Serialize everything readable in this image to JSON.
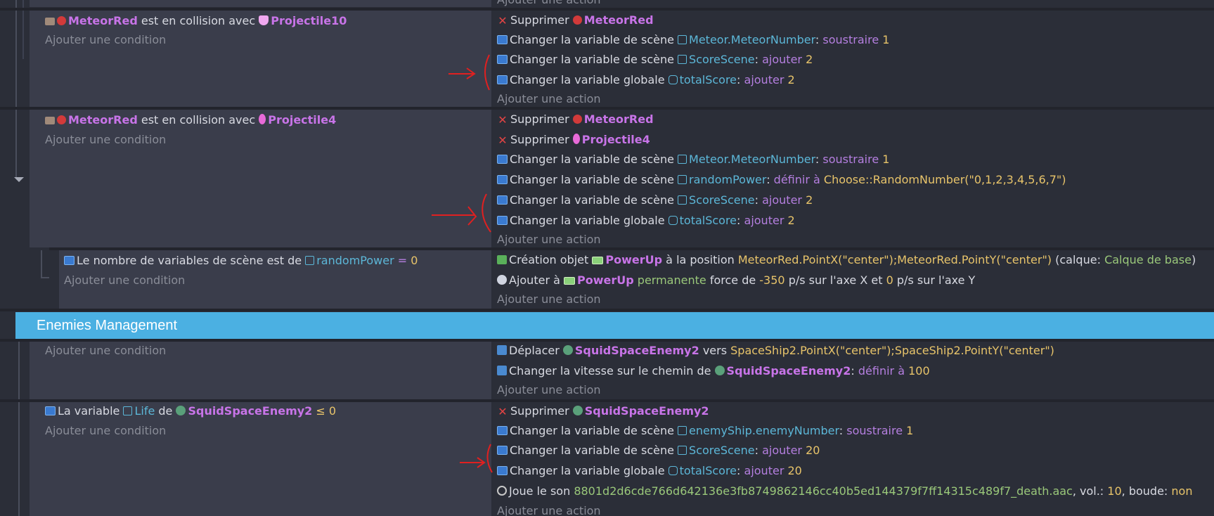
{
  "topcut": {
    "text": "Ajouter une action"
  },
  "event1": {
    "condition": {
      "object": "MeteorRed",
      "middle": "est en collision avec",
      "target": "Projectile10"
    },
    "add_condition": "Ajouter une condition",
    "actions": [
      {
        "type": "delete",
        "verb": "Supprimer",
        "object": "MeteorRed"
      },
      {
        "type": "var",
        "verb": "Changer la variable de scène",
        "variable": "Meteor.MeteorNumber",
        "op": "soustraire",
        "value": "1"
      },
      {
        "type": "var",
        "verb": "Changer la variable de scène",
        "variable": "ScoreScene",
        "op": "ajouter",
        "value": "2"
      },
      {
        "type": "gvar",
        "verb": "Changer la variable globale",
        "variable": "totalScore",
        "op": "ajouter",
        "value": "2"
      }
    ],
    "add_action": "Ajouter une action"
  },
  "event2": {
    "condition": {
      "object": "MeteorRed",
      "middle": "est en collision avec",
      "target": "Projectile4"
    },
    "add_condition": "Ajouter une condition",
    "actions": [
      {
        "type": "delete",
        "verb": "Supprimer",
        "object": "MeteorRed"
      },
      {
        "type": "delete",
        "verb": "Supprimer",
        "object": "Projectile4"
      },
      {
        "type": "var",
        "verb": "Changer la variable de scène",
        "variable": "Meteor.MeteorNumber",
        "op": "soustraire",
        "value": "1"
      },
      {
        "type": "var",
        "verb": "Changer la variable de scène",
        "variable": "randomPower",
        "op": "définir à",
        "value": "Choose::RandomNumber(\"0,1,2,3,4,5,6,7\")"
      },
      {
        "type": "var",
        "verb": "Changer la variable de scène",
        "variable": "ScoreScene",
        "op": "ajouter",
        "value": "2"
      },
      {
        "type": "gvar",
        "verb": "Changer la variable globale",
        "variable": "totalScore",
        "op": "ajouter",
        "value": "2"
      }
    ],
    "add_action": "Ajouter une action"
  },
  "event3": {
    "condition": {
      "text": "Le nombre de variables de scène est de",
      "variable": "randomPower",
      "eq": "=",
      "value": "0"
    },
    "add_condition": "Ajouter une condition",
    "actions": [
      {
        "verb": "Création objet",
        "object": "PowerUp",
        "pos_text": "à la position",
        "expr": "MeteorRed.PointX(\"center\");MeteorRed.PointY(\"center\")",
        "layer_open": "(calque:",
        "layer": "Calque de base",
        "layer_close": ")"
      },
      {
        "verb": "Ajouter à",
        "object": "PowerUp",
        "perm": "permanente",
        "f1": "force de",
        "xval": "-350",
        "f2": "p/s sur l'axe X et",
        "yval": "0",
        "f3": "p/s sur l'axe Y"
      }
    ],
    "add_action": "Ajouter une action"
  },
  "group": {
    "title": "Enemies Management"
  },
  "event4": {
    "add_condition": "Ajouter une condition",
    "actions": [
      {
        "verb": "Déplacer",
        "object": "SquidSpaceEnemy2",
        "mid": "vers",
        "expr": "SpaceShip2.PointX(\"center\");SpaceShip2.PointY(\"center\")"
      },
      {
        "verb": "Changer la vitesse sur le chemin de",
        "object": "SquidSpaceEnemy2",
        "colon": ":",
        "op": "définir à",
        "value": "100"
      }
    ],
    "add_action": "Ajouter une action"
  },
  "event5": {
    "condition": {
      "text": "La variable",
      "variable": "Life",
      "de": "de",
      "object": "SquidSpaceEnemy2",
      "cmp": "≤",
      "value": "0"
    },
    "add_condition": "Ajouter une condition",
    "actions": [
      {
        "type": "delete",
        "verb": "Supprimer",
        "object": "SquidSpaceEnemy2"
      },
      {
        "type": "var",
        "verb": "Changer la variable de scène",
        "variable": "enemyShip.enemyNumber",
        "op": "soustraire",
        "value": "1"
      },
      {
        "type": "var",
        "verb": "Changer la variable de scène",
        "variable": "ScoreScene",
        "op": "ajouter",
        "value": "20"
      },
      {
        "type": "gvar",
        "verb": "Changer la variable globale",
        "variable": "totalScore",
        "op": "ajouter",
        "value": "20"
      },
      {
        "type": "sound",
        "verb": "Joue le son",
        "file": "8801d2d6cde766d642136e3fb8749862146cc40b5ed144379f7ff14315c489f7_death.aac",
        "vol_label": ", vol.:",
        "vol": "10",
        "loop_label": ", boude:",
        "loop": "non"
      }
    ],
    "add_action": "Ajouter une action"
  },
  "colors": {
    "group_bg": "#4bb0e2",
    "object": "#c874e8",
    "variable": "#5cb7d8",
    "operator": "#b57fe0",
    "value": "#e8c46a",
    "annotation": "#e02020"
  }
}
